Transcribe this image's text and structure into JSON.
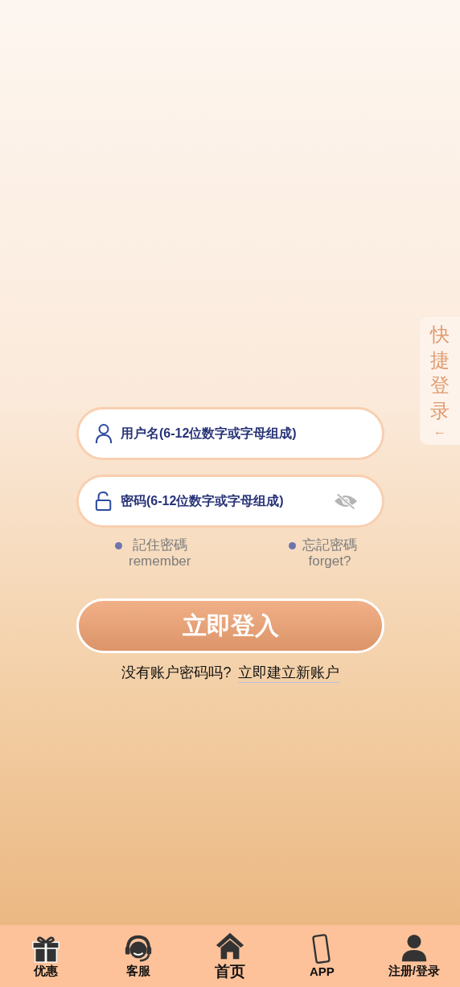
{
  "quick_login": {
    "label": "快捷登录",
    "arrow": "←"
  },
  "username_field": {
    "placeholder": "用户名(6-12位数字或字母组成)"
  },
  "password_field": {
    "placeholder": "密码(6-12位数字或字母组成)",
    "masked": true
  },
  "options": [
    {
      "label": "記住密碼",
      "sublabel": "remember"
    },
    {
      "label": "忘記密碼",
      "sublabel": "forget?"
    }
  ],
  "login_button": "立即登入",
  "signup": {
    "prompt": "没有账户密码吗?",
    "link": "立即建立新账户"
  },
  "bottom_nav": [
    {
      "kind": "gift",
      "label": "优惠",
      "selected": false
    },
    {
      "kind": "support",
      "label": "客服",
      "selected": false
    },
    {
      "kind": "home",
      "label": "首页",
      "selected": true
    },
    {
      "kind": "phone",
      "label": "APP",
      "selected": false
    },
    {
      "kind": "user",
      "label": "注册/登录",
      "selected": false
    }
  ]
}
